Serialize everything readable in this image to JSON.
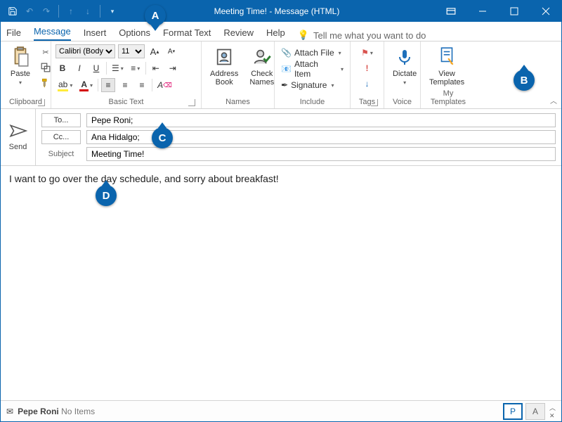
{
  "title": "Meeting Time! - Message (HTML)",
  "tabs": {
    "file": "File",
    "message": "Message",
    "insert": "Insert",
    "options": "Options",
    "format": "Format Text",
    "review": "Review",
    "help": "Help",
    "tell": "Tell me what you want to do"
  },
  "ribbon": {
    "clipboard": {
      "paste": "Paste",
      "label": "Clipboard"
    },
    "basictext": {
      "font": "Calibri (Body)",
      "size": "11",
      "label": "Basic Text"
    },
    "names": {
      "address": "Address\nBook",
      "check": "Check\nNames",
      "label": "Names"
    },
    "include": {
      "attachfile": "Attach File",
      "attachitem": "Attach Item",
      "signature": "Signature",
      "label": "Include"
    },
    "tags": {
      "label": "Tags"
    },
    "voice": {
      "dictate": "Dictate",
      "label": "Voice"
    },
    "templates": {
      "view": "View\nTemplates",
      "label": "My Templates"
    }
  },
  "compose": {
    "send": "Send",
    "to_btn": "To...",
    "cc_btn": "Cc...",
    "subject_lbl": "Subject",
    "to_val": "Pepe Roni;",
    "cc_val": "Ana Hidalgo;",
    "subject_val": "Meeting Time!",
    "body": "I want to go over the day schedule, and sorry about breakfast!"
  },
  "status": {
    "name": "Pepe Roni",
    "items": " No Items",
    "p": "P",
    "a": "A"
  },
  "callouts": {
    "a": "A",
    "b": "B",
    "c": "C",
    "d": "D"
  }
}
